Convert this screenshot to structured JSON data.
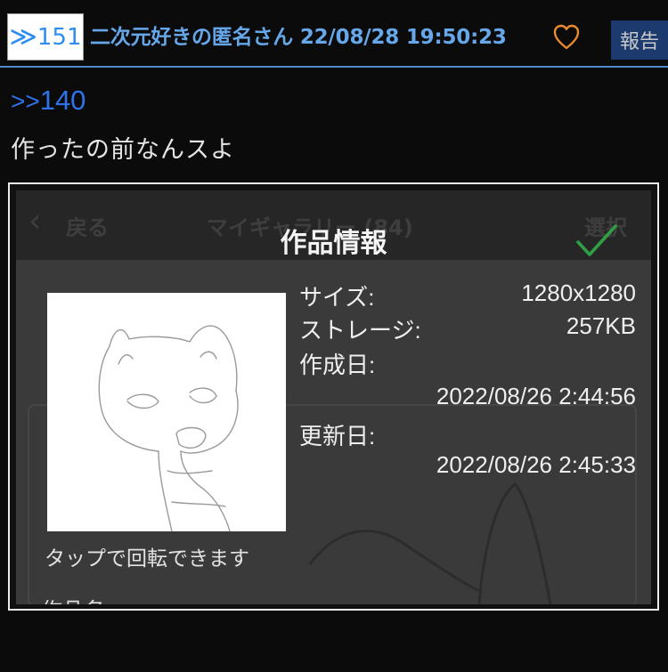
{
  "post": {
    "quote_mark": "≫",
    "number": "151",
    "author": "二次元好きの匿名さん",
    "datetime": "22/08/28 19:50:23",
    "report_label": "報告",
    "reply_quote_mark": ">>",
    "reply_to": "140",
    "message": "作ったの前なんスよ"
  },
  "image": {
    "bg_nav": {
      "back_label": "戻る",
      "gallery_title": "マイギャラリー (84)",
      "select_label": "選択"
    },
    "dialog_title": "作品情報",
    "info": {
      "size_label": "サイズ:",
      "size_value": "1280x1280",
      "storage_label": "ストレージ:",
      "storage_value": "257KB",
      "created_label": "作成日:",
      "created_value": "2022/08/26 2:44:56",
      "updated_label": "更新日:",
      "updated_value": "2022/08/26 2:45:33"
    },
    "rotate_hint": "タップで回転できます",
    "name_label": "作品名"
  },
  "colors": {
    "background": "#0b0b0c",
    "header_text": "#66a7ea",
    "number": "#2e8ef0",
    "anchor": "#2f73ea",
    "heart": "#e88a2e",
    "report_bg": "#1d3a6e",
    "divider": "#4f8ac9",
    "check": "#2ea043"
  },
  "icons": {
    "heart": "heart-icon",
    "check": "checkmark-icon",
    "back": "chevron-left-icon"
  }
}
